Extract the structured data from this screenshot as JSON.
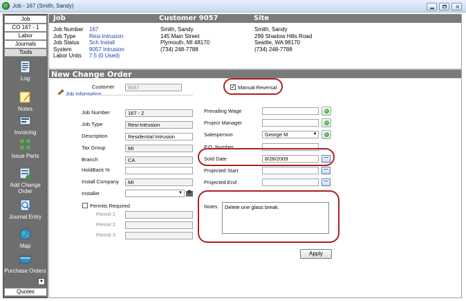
{
  "window": {
    "title": "Job - 167 (Smith, Sandy)"
  },
  "sidebar": {
    "tabs": [
      "Job",
      "CO 167 - 1",
      "Labor",
      "Journals",
      "Tools"
    ],
    "items": [
      {
        "label": "Log",
        "icon": "log-icon"
      },
      {
        "label": "Notes",
        "icon": "notes-icon"
      },
      {
        "label": "Invoicing",
        "icon": "invoicing-icon"
      },
      {
        "label": "Issue Parts",
        "icon": "issue-parts-icon"
      },
      {
        "label": "Add Change Order",
        "icon": "add-change-order-icon"
      },
      {
        "label": "Journal Entry",
        "icon": "journal-entry-icon"
      },
      {
        "label": "Map",
        "icon": "globe-icon"
      },
      {
        "label": "Purchase Orders",
        "icon": "purchase-orders-icon"
      }
    ],
    "bottom_tab": "Quotes"
  },
  "header": {
    "job_title": "Job",
    "customer_title": "Customer 9057",
    "site_title": "Site"
  },
  "job_info": {
    "labels": [
      "Job Number",
      "Job Type",
      "Job Status",
      "System",
      "Labor Units"
    ],
    "values": [
      "167",
      "Resi-Intrusion",
      "Sch Install",
      "9057 Intrusion",
      "7.5 (0 Used)"
    ]
  },
  "customer_info": [
    "Smith, Sandy",
    "145 Main Street",
    "Plymouth, MI  48170",
    "(734) 248-7788"
  ],
  "site_info": [
    "Smith, Sandy",
    "299 Shadow Hills Road",
    "Seattle, WA  98170",
    "(734) 248-7788"
  ],
  "change_order": {
    "section_title": "New Change Order",
    "customer_label": "Customer",
    "customer_value": "9057",
    "job_information_link": "Job Information",
    "manual_reversal_label": "Manual Reversal",
    "manual_reversal_checked": "✓",
    "left_fields": [
      {
        "label": "Job Number",
        "value": "167 - 2"
      },
      {
        "label": "Job Type",
        "value": "Resi-Intrusion"
      },
      {
        "label": "Description",
        "value": "Residential Intrusion"
      },
      {
        "label": "Tax Group",
        "value": "MI"
      },
      {
        "label": "Branch",
        "value": "CA"
      },
      {
        "label": "HoldBack  %",
        "value": ""
      },
      {
        "label": "Install Company",
        "value": "MI"
      },
      {
        "label": "Installer",
        "value": ""
      }
    ],
    "permits_label": "Permits Required",
    "permits": [
      "Permit 1",
      "Permit 2",
      "Permit 3"
    ],
    "right_fields": [
      {
        "label": "Prevailing Wage",
        "value": ""
      },
      {
        "label": "Project Manager",
        "value": ""
      },
      {
        "label": "Salesperson",
        "value": "George M"
      },
      {
        "label": "P.O. Number",
        "value": ""
      },
      {
        "label": "Sold Date",
        "value": "8/28/2009"
      },
      {
        "label": "Projected Start",
        "value": ""
      },
      {
        "label": "Projected End",
        "value": ""
      }
    ],
    "notes_label": "Notes",
    "notes_value": "Delete one glass break.",
    "apply_label": "Apply",
    "highlight_color": "#b01e1e"
  }
}
